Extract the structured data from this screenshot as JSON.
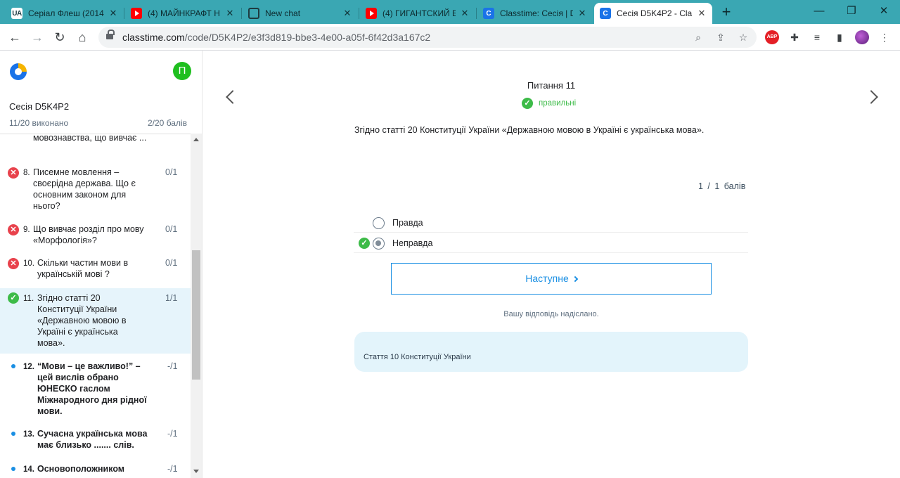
{
  "browser": {
    "tabs": [
      {
        "title": "Серіал Флеш (2014",
        "icon": "ua-icon"
      },
      {
        "title": "(4) МАЙНКРАФТ Н",
        "icon": "youtube-icon"
      },
      {
        "title": "New chat",
        "icon": "chatgpt-icon"
      },
      {
        "title": "(4) ГИГАНТСКИЙ Б",
        "icon": "youtube-icon"
      },
      {
        "title": "Classtime: Сесія | D",
        "icon": "classtime-icon"
      },
      {
        "title": "Сесія D5K4P2 - Cla",
        "icon": "classtime-icon",
        "active": true
      }
    ],
    "url_host": "classtime.com",
    "url_path": "/code/D5K4P2/e3f3d819-bbe3-4e00-a05f-6f42d3a167c2",
    "abp_label": "ABP"
  },
  "sidebar": {
    "avatar_letter": "П",
    "session_title": "Сесія D5K4P2",
    "done": "11/20 виконано",
    "points": "2/20 балів",
    "items": [
      {
        "num": "",
        "text": "мовознавства, що вивчає ...",
        "score": "",
        "status": "none"
      },
      {
        "num": "8.",
        "text": "Писемне мовлення – своєрідна держава. Що є основним законом для нього?",
        "score": "0/1",
        "status": "wrong"
      },
      {
        "num": "9.",
        "text": "Що вивчає розділ про мову «Морфологія»?",
        "score": "0/1",
        "status": "wrong"
      },
      {
        "num": "10.",
        "text": "Скільки частин мови в українській мові ?",
        "score": "0/1",
        "status": "wrong"
      },
      {
        "num": "11.",
        "text": "Згідно статті 20 Конституції України «Державною мовою в Україні є українська мова».",
        "score": "1/1",
        "status": "right"
      },
      {
        "num": "12.",
        "text": "“Мови – це важливо!” – цей вислів обрано ЮНЕСКО гаслом Міжнародного дня рідної мови.",
        "score": "-/1",
        "status": "pending"
      },
      {
        "num": "13.",
        "text": "Сучасна українська мова має близько ....... слів.",
        "score": "-/1",
        "status": "pending"
      },
      {
        "num": "14.",
        "text": "Основоположником",
        "score": "-/1",
        "status": "pending"
      }
    ]
  },
  "main": {
    "question_title": "Питання 11",
    "status_text": "правильні",
    "question_text": "Згідно статті 20 Конституції України «Державною мовою в Україні є українська мова».",
    "score_line": "1 / 1 балів",
    "options": [
      {
        "label": "Правда",
        "selected": false,
        "correct": false
      },
      {
        "label": "Неправда",
        "selected": true,
        "correct": true
      }
    ],
    "next_label": "Наступне",
    "submitted_text": "Вашу відповідь надіслано.",
    "explanation": "Стаття 10 Конституції України"
  },
  "colors": {
    "tabbar": "#3aa7b3",
    "accent_blue": "#1a8fe3",
    "correct_green": "#3dbb48",
    "wrong_red": "#e8424c",
    "explanation_bg": "#e3f4fb"
  }
}
